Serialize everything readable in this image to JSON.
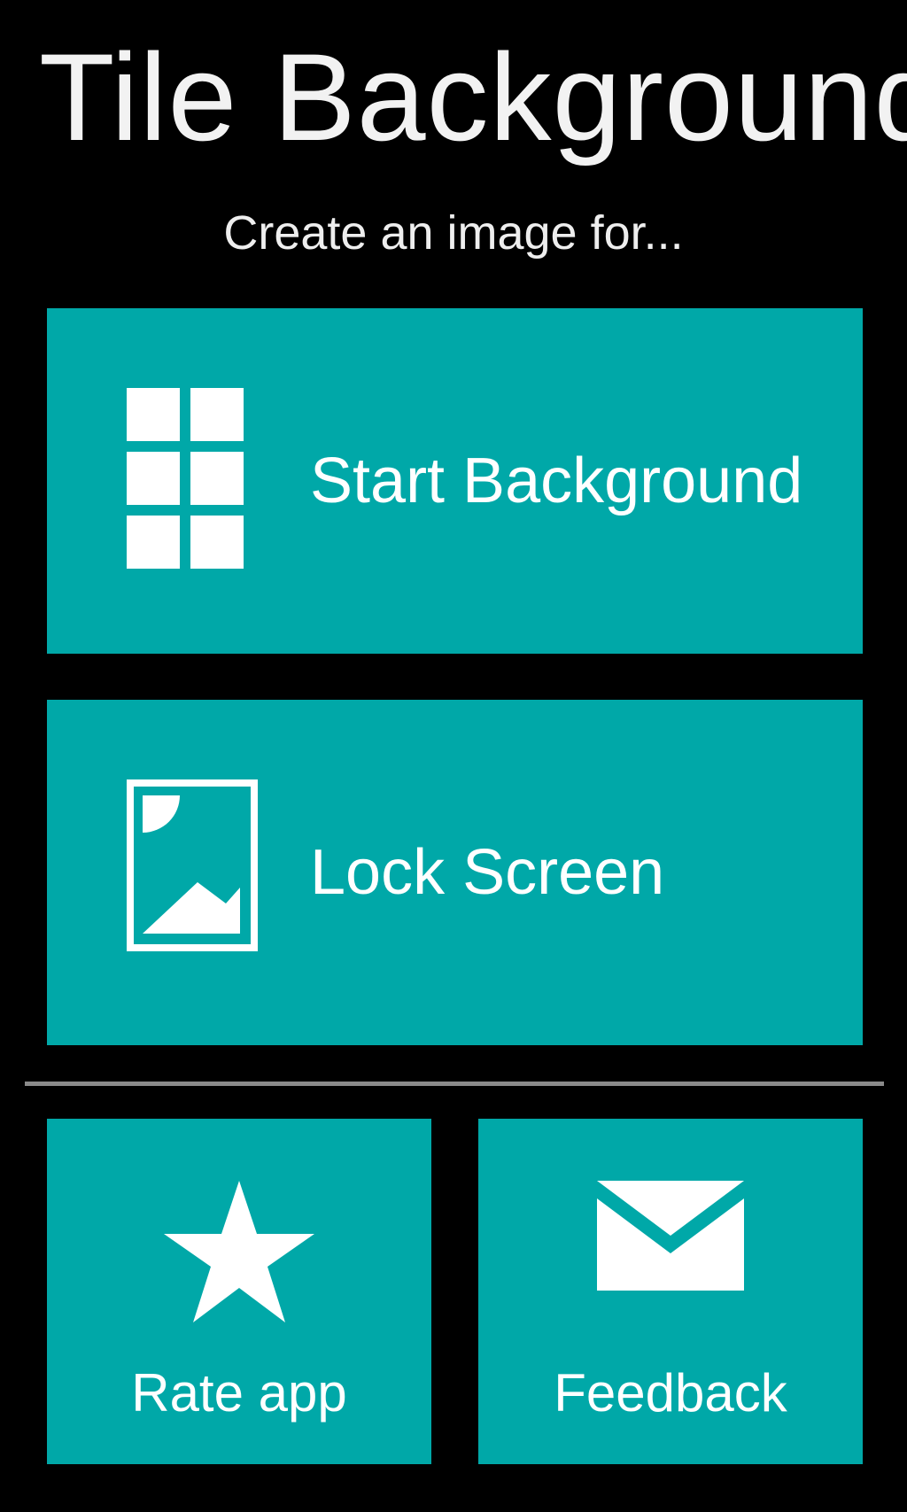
{
  "app": {
    "title": "Tile Background",
    "subtitle": "Create an image for..."
  },
  "tiles": {
    "start": {
      "label": "Start Background",
      "icon": "start-grid-icon"
    },
    "lock": {
      "label": "Lock Screen",
      "icon": "picture-icon"
    },
    "rate": {
      "label": "Rate app",
      "icon": "star-icon"
    },
    "feedback": {
      "label": "Feedback",
      "icon": "envelope-icon"
    }
  },
  "colors": {
    "background": "#000000",
    "tile": "#00a8a8",
    "divider": "#8a8a8a",
    "text": "#ffffff"
  }
}
